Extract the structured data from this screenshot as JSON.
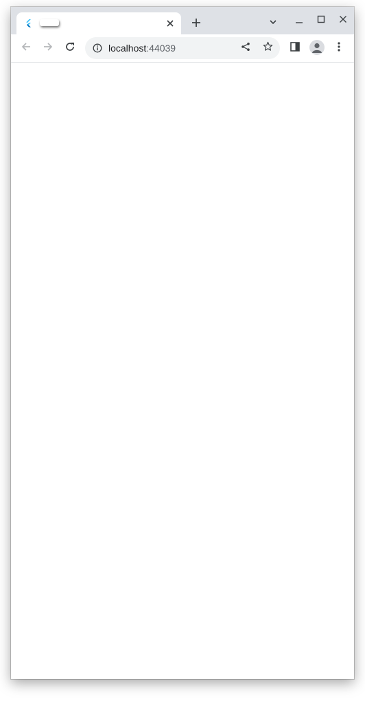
{
  "browser": {
    "tab": {
      "title": "",
      "favicon": "flutter-icon"
    },
    "omnibox": {
      "host": "localhost",
      "port": ":44039"
    },
    "icons": {
      "close_tab": "close-icon",
      "new_tab": "plus-icon",
      "tab_search": "chevron-down-icon",
      "minimize": "minimize-icon",
      "maximize": "maximize-icon",
      "close_window": "close-icon",
      "back": "arrow-left-icon",
      "forward": "arrow-right-icon",
      "reload": "reload-icon",
      "site_info": "info-icon",
      "share": "share-icon",
      "bookmark": "star-icon",
      "side_panel": "side-panel-icon",
      "profile": "avatar",
      "menu": "kebab-menu-icon"
    },
    "colors": {
      "tabstrip": "#dee1e6",
      "omnibox": "#f1f3f4",
      "icon": "#5f6368",
      "icon_disabled": "#b5b7ba",
      "flutter_light": "#47c5fb",
      "flutter_dark": "#0175c2"
    }
  },
  "page": {
    "content": ""
  }
}
